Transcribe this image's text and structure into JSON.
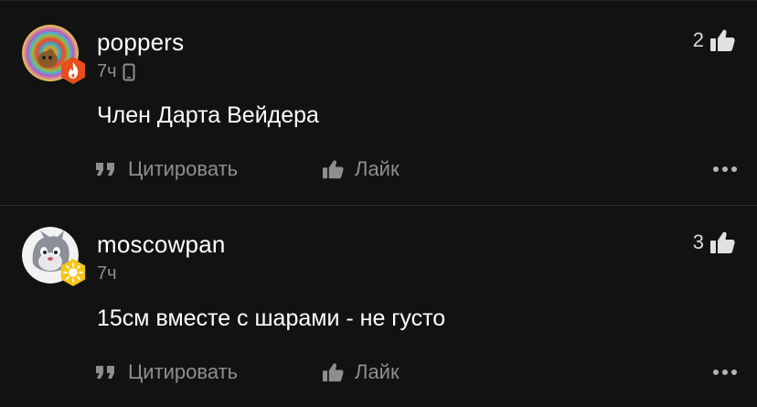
{
  "comments": [
    {
      "username": "poppers",
      "time": "7ч",
      "rating": "2",
      "text": "Член Дарта Вейдера",
      "quote_label": "Цитировать",
      "like_label": "Лайк",
      "badge_color": "#e84e1b"
    },
    {
      "username": "moscowpan",
      "time": "7ч",
      "rating": "3",
      "text": "15см вместе с шарами - не густо",
      "quote_label": "Цитировать",
      "like_label": "Лайк",
      "badge_color": "#f5c518"
    }
  ],
  "icons": {
    "device": "phone-icon",
    "like": "thumbs-up-icon",
    "quote": "quote-icon",
    "more": "more-dots-icon"
  },
  "colors": {
    "background": "#121212",
    "muted": "#8e8e8e",
    "text": "#ffffff"
  }
}
